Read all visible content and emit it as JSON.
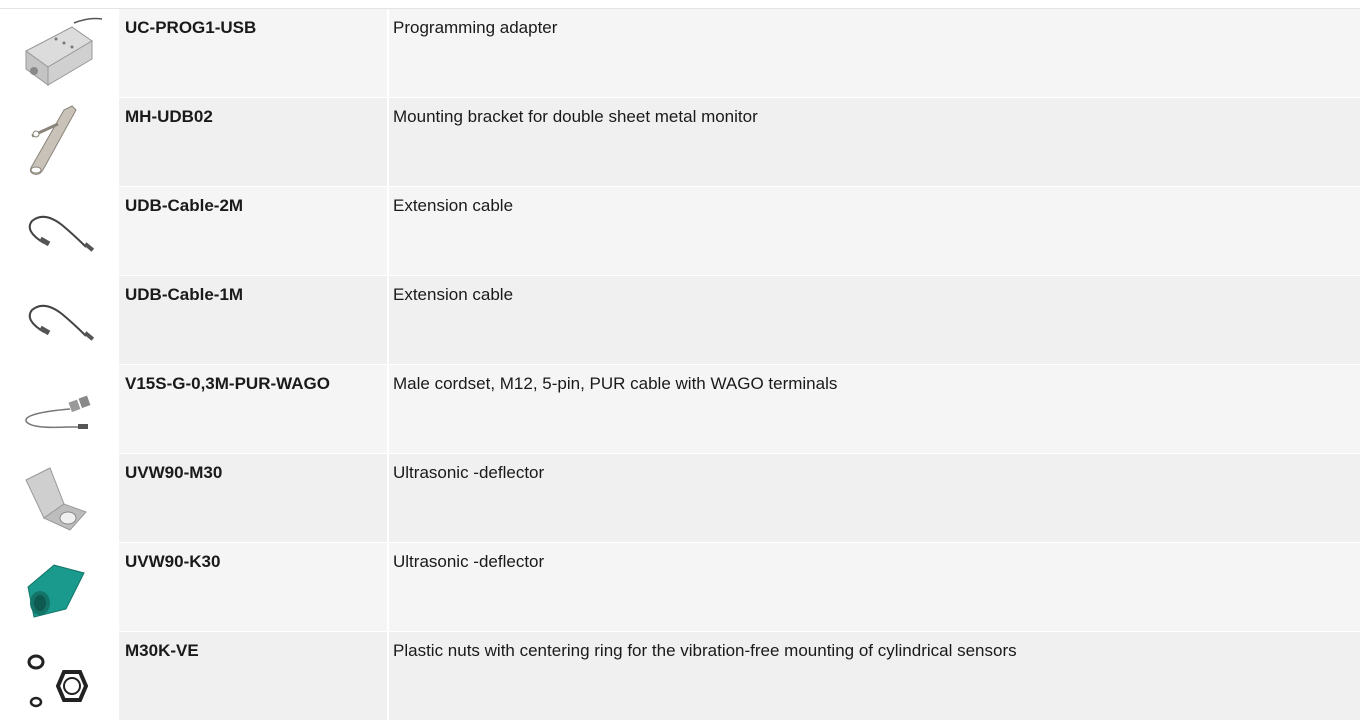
{
  "accessories": [
    {
      "code": "UC-PROG1-USB",
      "description": "Programming adapter",
      "image": "programming-adapter-image"
    },
    {
      "code": "MH-UDB02",
      "description": "Mounting bracket for double sheet metal monitor",
      "image": "mounting-bracket-image"
    },
    {
      "code": "UDB-Cable-2M",
      "description": "Extension cable",
      "image": "extension-cable-image"
    },
    {
      "code": "UDB-Cable-1M",
      "description": "Extension cable",
      "image": "extension-cable-image"
    },
    {
      "code": "V15S-G-0,3M-PUR-WAGO",
      "description": "Male cordset, M12, 5-pin, PUR cable with WAGO terminals",
      "image": "cordset-wago-image"
    },
    {
      "code": "UVW90-M30",
      "description": "Ultrasonic -deflector",
      "image": "metal-deflector-image"
    },
    {
      "code": "UVW90-K30",
      "description": "Ultrasonic -deflector",
      "image": "plastic-deflector-image"
    },
    {
      "code": "M30K-VE",
      "description": "Plastic nuts with centering ring for the vibration-free mounting of cylindrical sensors",
      "image": "plastic-nuts-image"
    }
  ],
  "colors": {
    "deflector_plastic": "#1a9a8c",
    "metal": "#b8b8b8",
    "cable": "#444444"
  }
}
